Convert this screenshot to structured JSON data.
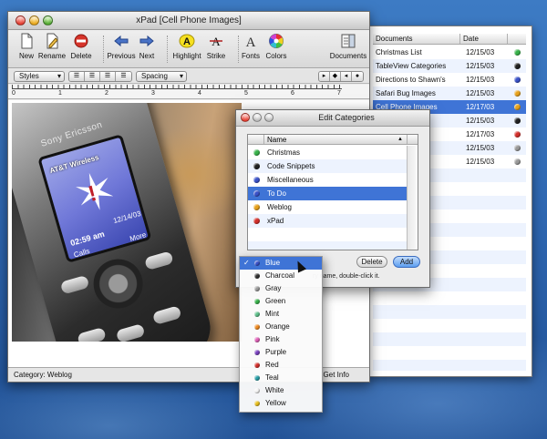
{
  "main_window": {
    "title": "xPad [Cell Phone Images]",
    "toolbar": {
      "new": "New",
      "rename": "Rename",
      "delete": "Delete",
      "previous": "Previous",
      "next": "Next",
      "highlight": "Highlight",
      "strike": "Strike",
      "fonts": "Fonts",
      "colors": "Colors",
      "documents": "Documents"
    },
    "format_bar": {
      "styles": "Styles",
      "spacing": "Spacing"
    },
    "ruler_numbers": [
      "0",
      "1",
      "2",
      "3",
      "4",
      "5",
      "6",
      "7"
    ],
    "photo": {
      "brand": "Sony Ericsson",
      "screen_carrier": "AT&T Wireless",
      "screen_date": "12/14/03",
      "screen_time": "02:59 am",
      "softkey_left": "Calls",
      "softkey_right": "More"
    },
    "status": {
      "category": "Category: Weblog",
      "get_info": "Get Info"
    }
  },
  "documents_window": {
    "columns": [
      "Documents",
      "Date"
    ],
    "rows": [
      {
        "name": "Christmas List",
        "date": "12/15/03",
        "color": "#38b24a"
      },
      {
        "name": "TableView Categories",
        "date": "12/15/03",
        "color": "#222222"
      },
      {
        "name": "Directions to Shawn's",
        "date": "12/15/03",
        "color": "#3a52c8"
      },
      {
        "name": "Safari Bug Images",
        "date": "12/15/03",
        "color": "#e8a21c"
      },
      {
        "name": "Cell Phone Images",
        "date": "12/17/03",
        "color": "#e8a21c",
        "selected": true
      },
      {
        "name": "",
        "date": "12/15/03",
        "color": "#222222"
      },
      {
        "name": "",
        "date": "12/17/03",
        "color": "#d3302c"
      },
      {
        "name": "",
        "date": "12/15/03",
        "color": "#999999"
      },
      {
        "name": "",
        "date": "12/15/03",
        "color": "#999999"
      }
    ]
  },
  "edit_categories": {
    "title": "Edit Categories",
    "column_name": "Name",
    "rows": [
      {
        "name": "Christmas",
        "color": "#38b24a"
      },
      {
        "name": "Code Snippets",
        "color": "#222222"
      },
      {
        "name": "Miscellaneous",
        "color": "#3a52c8"
      },
      {
        "name": "To Do",
        "color": "#3a52c8",
        "selected": true
      },
      {
        "name": "Weblog",
        "color": "#e8a21c"
      },
      {
        "name": "xPad",
        "color": "#d3302c"
      }
    ],
    "delete_label": "Delete",
    "add_label": "Add",
    "hint": "ry name, double-click it."
  },
  "color_menu": {
    "check": "✓",
    "items": [
      {
        "label": "Blue",
        "color": "#3a52c8",
        "selected": true
      },
      {
        "label": "Charcoal",
        "color": "#333333"
      },
      {
        "label": "Gray",
        "color": "#9a9a9a"
      },
      {
        "label": "Green",
        "color": "#38b24a"
      },
      {
        "label": "Mint",
        "color": "#5ec08a"
      },
      {
        "label": "Orange",
        "color": "#f08a20"
      },
      {
        "label": "Pink",
        "color": "#e060b8"
      },
      {
        "label": "Purple",
        "color": "#7a42c0"
      },
      {
        "label": "Red",
        "color": "#d3302c"
      },
      {
        "label": "Teal",
        "color": "#2aa0a8"
      },
      {
        "label": "White",
        "color": "#f4f4f4"
      },
      {
        "label": "Yellow",
        "color": "#e8c020"
      }
    ]
  }
}
